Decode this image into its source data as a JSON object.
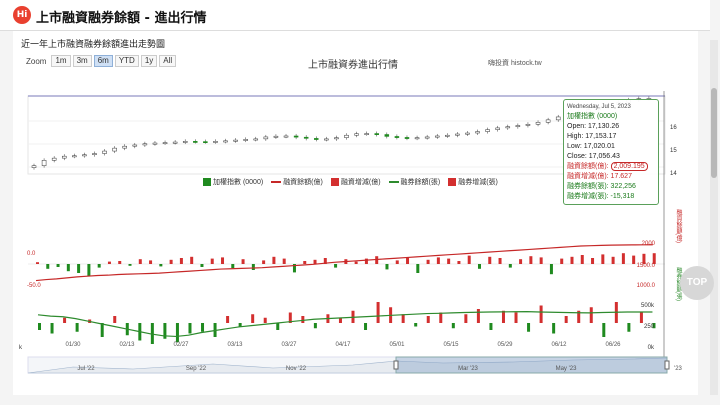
{
  "header": {
    "logo_text": "Hi",
    "title": "上市融資融券餘額 - 進出行情"
  },
  "card": {
    "subtitle": "近一年上市融資融券餘額進出走勢圖"
  },
  "zoom": {
    "label": "Zoom",
    "buttons": [
      "1m",
      "3m",
      "6m",
      "YTD",
      "1y",
      "All"
    ],
    "active": "6m"
  },
  "chart": {
    "title": "上市融資券進出行情",
    "credit": "嗨投資 histock.tw"
  },
  "tooltip": {
    "date": "Wednesday, Jul 5, 2023",
    "series": "加權指數 (0000)",
    "open": "Open: 17,130.26",
    "high": "High: 17,153.17",
    "low": "Low: 17,020.01",
    "close": "Close: 17,056.43",
    "margin_balance_label": "融資餘額(億):",
    "margin_balance_value": "2,009.195",
    "margin_change": "融資增減(億): 17.627",
    "short_balance": "融券餘額(張): 322,256",
    "short_change": "融券增減(張): -15,318"
  },
  "legend": [
    "加權指數 (0000)",
    "融資餘額(億)",
    "融資增減(億)",
    "融券餘額(張)",
    "融券增減(張)"
  ],
  "axes": {
    "price_ticks": [
      "16",
      "15",
      "14"
    ],
    "margin_left_ticks": [
      "0.0",
      "-50.0"
    ],
    "margin_right_ticks": [
      "2000",
      "1500.0",
      "1000.0"
    ],
    "margin_axis_title": "融資餘額(億)",
    "short_right_ticks": [
      "500k",
      "250",
      "0k"
    ],
    "short_axis_title": "融券餘額(張)",
    "short_left_tick": "k",
    "x_ticks": [
      "01/30",
      "02/13",
      "02/27",
      "03/13",
      "03/27",
      "04/17",
      "05/01",
      "05/15",
      "05/29",
      "06/12",
      "06/26"
    ],
    "nav_ticks": [
      "Jul '22",
      "Sep '22",
      "Nov '22",
      "Mar '23",
      "May '23",
      "'23"
    ]
  },
  "top_button": "TOP",
  "colors": {
    "up": "#d32f2f",
    "down": "#1f8a1f",
    "margin_line": "#c62828",
    "short_line": "#2e8b2e",
    "nav": "#9fb3cc"
  },
  "chart_data": {
    "type": "candlestick",
    "index_close": [
      14300,
      14520,
      14610,
      14690,
      14710,
      14750,
      14800,
      14900,
      15020,
      15100,
      15150,
      15200,
      15230,
      15250,
      15270,
      15300,
      15290,
      15280,
      15300,
      15320,
      15350,
      15380,
      15400,
      15480,
      15510,
      15520,
      15470,
      15420,
      15380,
      15400,
      15450,
      15550,
      15610,
      15620,
      15580,
      15500,
      15460,
      15430,
      15450,
      15480,
      15520,
      15550,
      15600,
      15640,
      15700,
      15780,
      15850,
      15900,
      15950,
      16000,
      16080,
      16180,
      16300,
      16420,
      16500,
      16600,
      16700,
      16800,
      16900,
      17000,
      17050,
      17056
    ],
    "margin_change": [
      3,
      -8,
      -5,
      -12,
      -15,
      -20,
      -6,
      4,
      5,
      -3,
      8,
      6,
      -4,
      7,
      10,
      12,
      -5,
      9,
      11,
      -7,
      8,
      -10,
      6,
      12,
      9,
      -14,
      5,
      7,
      10,
      -6,
      8,
      4,
      9,
      13,
      -9,
      6,
      10,
      -15,
      7,
      11,
      9,
      5,
      14,
      -8,
      12,
      10,
      -6,
      8,
      13,
      11,
      -17,
      9,
      12,
      15,
      10,
      16,
      12,
      18,
      14,
      17,
      18
    ],
    "margin_balance": [
      1480,
      1495,
      1505,
      1520,
      1535,
      1545,
      1555,
      1560,
      1570,
      1575,
      1580,
      1585,
      1590,
      1600,
      1610,
      1620,
      1630,
      1640,
      1650,
      1655,
      1660,
      1665,
      1670,
      1680,
      1690,
      1700,
      1710,
      1720,
      1735,
      1750,
      1760,
      1770,
      1780,
      1790,
      1800,
      1810,
      1820,
      1830,
      1840,
      1850,
      1860,
      1870,
      1880,
      1890,
      1900,
      1910,
      1920,
      1930,
      1940,
      1950,
      1960,
      1970,
      1980,
      1990,
      1995,
      2000,
      2003,
      2005,
      2007,
      2008,
      2009
    ],
    "short_change": [
      -20,
      -30,
      15,
      -25,
      10,
      -40,
      20,
      -35,
      -50,
      -60,
      -45,
      -55,
      -30,
      -25,
      -40,
      20,
      -10,
      25,
      15,
      -20,
      30,
      20,
      -15,
      25,
      15,
      35,
      -20,
      60,
      45,
      25,
      -10,
      20,
      30,
      -15,
      25,
      40,
      -20,
      35,
      30,
      -25,
      50,
      -30,
      20,
      35,
      45,
      -40,
      60,
      -25,
      30,
      -15
    ],
    "short_balance": [
      300,
      290,
      285,
      270,
      250,
      230,
      210,
      190,
      170,
      150,
      135,
      130,
      140,
      160,
      175,
      190,
      205,
      215,
      225,
      235,
      245,
      255,
      265,
      270,
      275,
      280,
      285,
      290,
      295,
      300,
      305,
      310,
      312,
      315,
      318,
      320,
      322,
      323,
      324,
      325,
      322,
      320,
      318,
      316,
      315,
      318,
      320,
      322,
      322,
      322
    ]
  }
}
